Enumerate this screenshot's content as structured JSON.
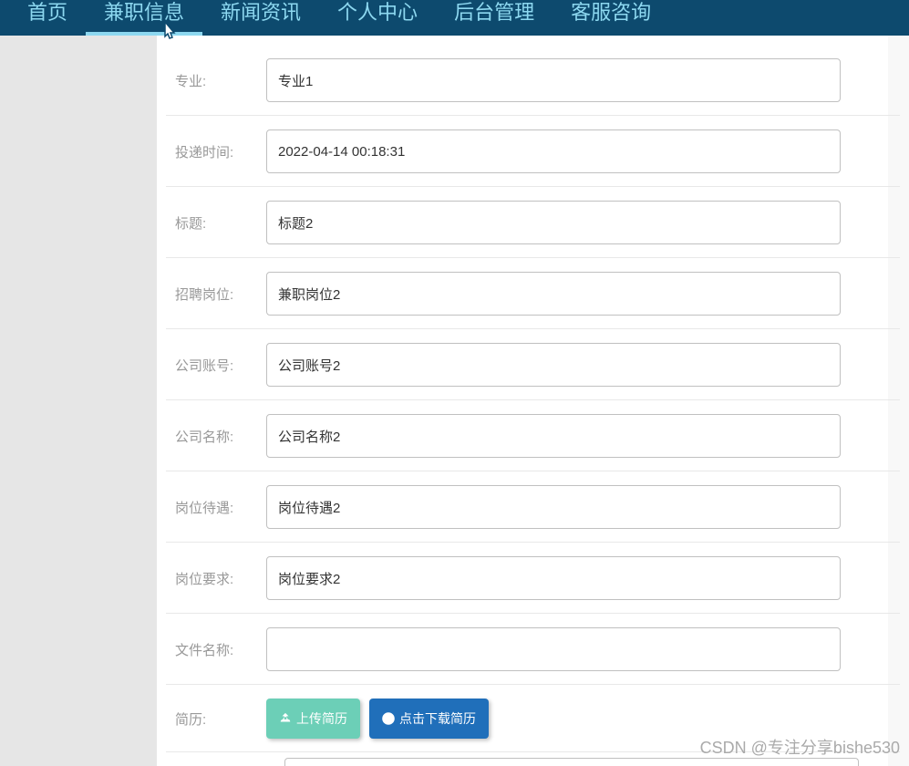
{
  "nav": {
    "items": [
      {
        "label": "首页",
        "active": false
      },
      {
        "label": "兼职信息",
        "active": true
      },
      {
        "label": "新闻资讯",
        "active": false
      },
      {
        "label": "个人中心",
        "active": false
      },
      {
        "label": "后台管理",
        "active": false
      },
      {
        "label": "客服咨询",
        "active": false
      }
    ]
  },
  "form": {
    "fields": [
      {
        "label": "专业:",
        "value": "专业1",
        "name": "major"
      },
      {
        "label": "投递时间:",
        "value": "2022-04-14 00:18:31",
        "name": "submit-time"
      },
      {
        "label": "标题:",
        "value": "标题2",
        "name": "title"
      },
      {
        "label": "招聘岗位:",
        "value": "兼职岗位2",
        "name": "position"
      },
      {
        "label": "公司账号:",
        "value": "公司账号2",
        "name": "company-account"
      },
      {
        "label": "公司名称:",
        "value": "公司名称2",
        "name": "company-name"
      },
      {
        "label": "岗位待遇:",
        "value": "岗位待遇2",
        "name": "salary"
      },
      {
        "label": "岗位要求:",
        "value": "岗位要求2",
        "name": "requirement"
      },
      {
        "label": "文件名称:",
        "value": "",
        "name": "file-name"
      }
    ],
    "resume_label": "简历:",
    "upload_button": "上传简历",
    "download_button": "点击下载简历"
  },
  "watermark": "CSDN @专注分享bishe530"
}
